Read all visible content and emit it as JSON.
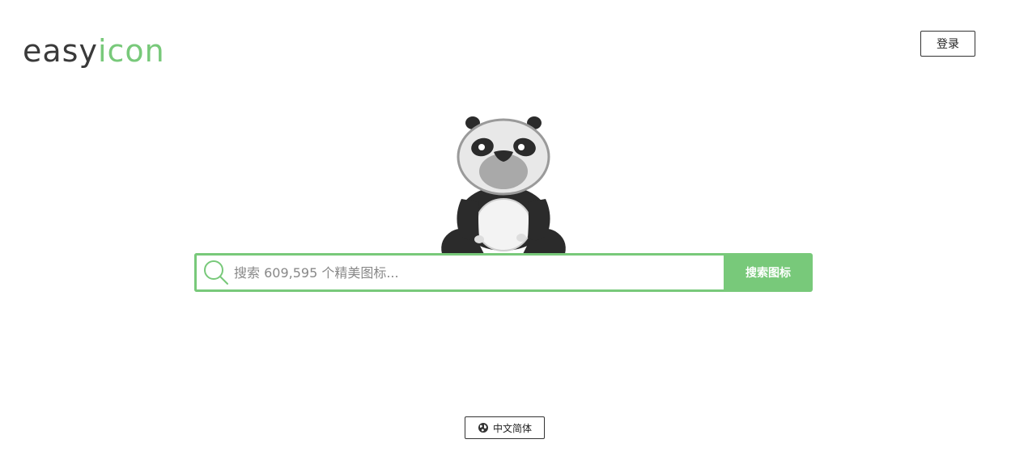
{
  "header": {
    "logo": {
      "part_a": "easy",
      "part_b": "icon"
    },
    "login_label": "登录"
  },
  "hero": {
    "mascot": "panda-mascot"
  },
  "search": {
    "placeholder": "搜索 609,595 个精美图标...",
    "value": "",
    "button_label": "搜索图标",
    "icon": "search-icon"
  },
  "footer": {
    "language_label": "中文简体",
    "language_icon": "globe-icon"
  },
  "colors": {
    "accent": "#78c97a",
    "text": "#333333",
    "background": "#ffffff"
  }
}
